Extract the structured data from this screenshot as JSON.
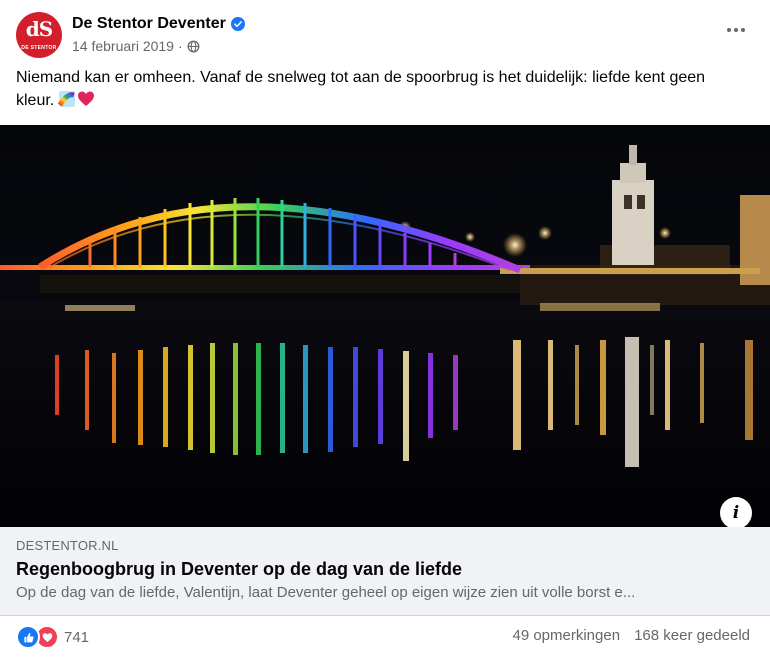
{
  "post": {
    "author": "De Stentor Deventer",
    "avatar_mark": "dS",
    "avatar_sub": "DE STENTOR",
    "date": "14 februari 2019",
    "separator": "·",
    "text": "Niemand kan er omheen. Vanaf de snelweg tot aan de spoorbrug is het duidelijk: liefde kent geen kleur.",
    "emojis": [
      "rainbow",
      "red-heart"
    ]
  },
  "link": {
    "domain": "DESTENTOR.NL",
    "title": "Regenboogbrug in Deventer op de dag van de liefde",
    "description": "Op de dag van de liefde, Valentijn, laat Deventer geheel op eigen wijze zien uit volle borst e..."
  },
  "stats": {
    "reaction_count": "741",
    "comments": "49 opmerkingen",
    "shares": "168 keer gedeeld"
  },
  "colors": {
    "primary_text": "#050505",
    "secondary_text": "#65676b",
    "link_bg": "#f0f2f5",
    "like_blue": "#1877f2",
    "love_red": "#f33e58",
    "brand_red": "#d21f2b"
  },
  "icons": [
    "verified-badge-icon",
    "globe-icon",
    "more-options-icon",
    "info-icon",
    "like-reaction-icon",
    "love-reaction-icon"
  ]
}
